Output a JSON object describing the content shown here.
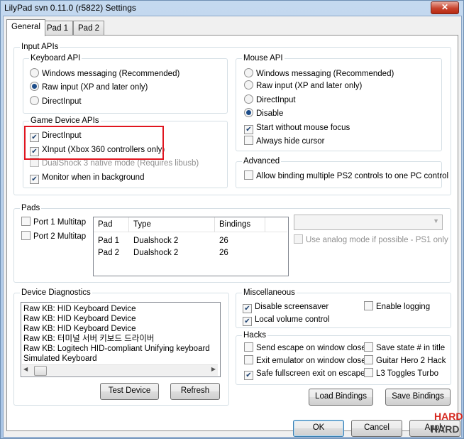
{
  "window": {
    "title": "LilyPad svn 0.11.0 (r5822) Settings",
    "close_label": "✕"
  },
  "tabs": [
    "General",
    "Pad 1",
    "Pad 2"
  ],
  "input_apis": {
    "title": "Input APIs",
    "keyboard": {
      "title": "Keyboard API",
      "options": [
        "Windows messaging (Recommended)",
        "Raw input (XP and later only)",
        "DirectInput"
      ],
      "selected": 1
    },
    "game_device": {
      "title": "Game Device APIs",
      "items": [
        {
          "label": "DirectInput",
          "checked": true,
          "disabled": false
        },
        {
          "label": "XInput (Xbox 360 controllers only)",
          "checked": true,
          "disabled": false
        },
        {
          "label": "DualShock 3 native mode (Requires libusb)",
          "checked": false,
          "disabled": true
        },
        {
          "label": "Monitor when in background",
          "checked": true,
          "disabled": false
        }
      ]
    },
    "mouse": {
      "title": "Mouse API",
      "options": [
        "Windows messaging (Recommended)",
        "Raw input (XP and later only)",
        "DirectInput",
        "Disable"
      ],
      "selected": 3,
      "checks": [
        {
          "label": "Start without mouse focus",
          "checked": true
        },
        {
          "label": "Always hide cursor",
          "checked": false
        }
      ]
    },
    "advanced": {
      "title": "Advanced",
      "label": "Allow binding multiple PS2 controls to one PC control",
      "checked": false
    }
  },
  "pads": {
    "title": "Pads",
    "multitap": [
      {
        "label": "Port 1 Multitap",
        "checked": false
      },
      {
        "label": "Port 2 Multitap",
        "checked": false
      }
    ],
    "columns": [
      "Pad",
      "Type",
      "Bindings"
    ],
    "rows": [
      [
        "Pad 1",
        "Dualshock 2",
        "26"
      ],
      [
        "Pad 2",
        "Dualshock 2",
        "26"
      ]
    ],
    "combo_value": "",
    "analog": {
      "label": "Use analog mode if possible - PS1 only",
      "checked": false
    }
  },
  "diagnostics": {
    "title": "Device Diagnostics",
    "items": [
      "Raw KB: HID Keyboard Device",
      "Raw KB: HID Keyboard Device",
      "Raw KB: HID Keyboard Device",
      "Raw KB: 터미널 서버 키보드 드라이버",
      "Raw KB: Logitech HID-compliant Unifying keyboard",
      "Simulated Keyboard"
    ],
    "test_label": "Test Device",
    "refresh_label": "Refresh"
  },
  "misc": {
    "title": "Miscellaneous",
    "items": [
      {
        "label": "Disable screensaver",
        "checked": true
      },
      {
        "label": "Enable logging",
        "checked": false
      },
      {
        "label": "Local volume control",
        "checked": true
      }
    ]
  },
  "hacks": {
    "title": "Hacks",
    "items": [
      {
        "label": "Send escape on window close",
        "checked": false
      },
      {
        "label": "Save state # in title",
        "checked": false
      },
      {
        "label": "Exit emulator on window close",
        "checked": false
      },
      {
        "label": "Guitar Hero 2 Hack",
        "checked": false
      },
      {
        "label": "Safe fullscreen exit on escape",
        "checked": true
      },
      {
        "label": "L3 Toggles Turbo",
        "checked": false
      }
    ]
  },
  "buttons": {
    "load": "Load Bindings",
    "save": "Save Bindings",
    "ok": "OK",
    "cancel": "Cancel",
    "apply": "Apply"
  },
  "watermark": {
    "line1": "HARD",
    "line2": "HARD"
  },
  "colors": {
    "highlight": "#e0151f",
    "titlebar": "#b9d1ea",
    "close": "#c8432d"
  }
}
